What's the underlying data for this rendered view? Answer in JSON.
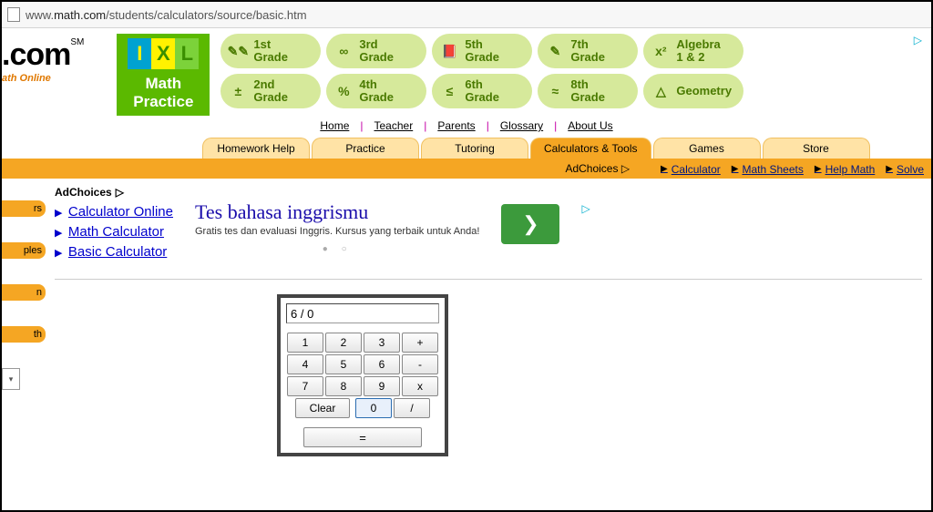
{
  "url": {
    "pre": "www.",
    "dark": "math.com",
    "post": "/students/calculators/source/basic.htm"
  },
  "logo": {
    "com": ".com",
    "sm": "SM",
    "sub": "ath Online"
  },
  "ixl": {
    "line1": "Math",
    "line2": "Practice",
    "i": "I",
    "x": "X",
    "l": "L"
  },
  "grades": {
    "row1": [
      {
        "icon": "✎✎",
        "label": "1st Grade"
      },
      {
        "icon": "∞",
        "label": "3rd Grade"
      },
      {
        "icon": "📕",
        "label": "5th Grade"
      },
      {
        "icon": "✎",
        "label": "7th Grade"
      },
      {
        "icon": "x²",
        "label": "Algebra 1 & 2"
      }
    ],
    "row2": [
      {
        "icon": "±",
        "label": "2nd Grade"
      },
      {
        "icon": "%",
        "label": "4th Grade"
      },
      {
        "icon": "≤",
        "label": "6th Grade"
      },
      {
        "icon": "≈",
        "label": "8th Grade"
      },
      {
        "icon": "△",
        "label": "Geometry"
      }
    ]
  },
  "toplinks": [
    "Home",
    "Teacher",
    "Parents",
    "Glossary",
    "About Us"
  ],
  "tabs": [
    "Homework Help",
    "Practice",
    "Tutoring",
    "Calculators & Tools",
    "Games",
    "Store"
  ],
  "active_tab_index": 3,
  "orange_links": [
    "Calculator",
    "Math Sheets",
    "Help Math",
    "Solve"
  ],
  "adchoices": "AdChoices",
  "left_tabs": [
    "rs",
    "ples",
    "n",
    "th"
  ],
  "blue_links": [
    "Calculator Online",
    "Math Calculator",
    "Basic Calculator"
  ],
  "ad": {
    "title": "Tes bahasa inggrismu",
    "sub": "Gratis tes dan evaluasi Inggris. Kursus yang terbaik untuk Anda!",
    "arrow": "❯"
  },
  "calc": {
    "display": "6 / 0",
    "keys4x4": [
      [
        "1",
        "2",
        "3",
        "+"
      ],
      [
        "4",
        "5",
        "6",
        "-"
      ],
      [
        "7",
        "8",
        "9",
        "x"
      ]
    ],
    "row5": {
      "clear": "Clear",
      "zero": "0",
      "div": "/"
    },
    "equals": "="
  }
}
